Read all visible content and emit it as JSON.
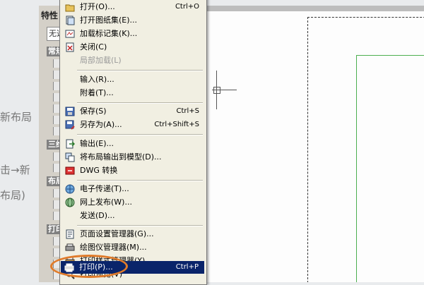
{
  "background": {
    "left_text_1": "新布局",
    "left_text_2": "击→新",
    "left_text_3": "布局)"
  },
  "properties_panel": {
    "title": "特性",
    "selection": "无选",
    "sections": [
      "常规",
      "三维",
      "布局",
      "打印"
    ]
  },
  "file_menu": {
    "items": [
      {
        "label": "打开(O)...",
        "shortcut": "Ctrl+O",
        "icon": "open-folder-icon"
      },
      {
        "label": "打开图纸集(E)...",
        "shortcut": "",
        "icon": "sheet-set-icon"
      },
      {
        "label": "加载标记集(K)...",
        "shortcut": "",
        "icon": "markup-set-icon"
      },
      {
        "label": "关闭(C)",
        "shortcut": "",
        "icon": "close-doc-icon"
      },
      {
        "label": "局部加载(L)",
        "shortcut": "",
        "icon": ""
      },
      {
        "label": "输入(R)...",
        "shortcut": "",
        "icon": ""
      },
      {
        "label": "附着(T)...",
        "shortcut": "",
        "icon": ""
      },
      {
        "label": "保存(S)",
        "shortcut": "Ctrl+S",
        "icon": "save-icon"
      },
      {
        "label": "另存为(A)...",
        "shortcut": "Ctrl+Shift+S",
        "icon": "save-as-icon"
      },
      {
        "label": "输出(E)...",
        "shortcut": "",
        "icon": "export-icon"
      },
      {
        "label": "将布局输出到模型(D)...",
        "shortcut": "",
        "icon": "layout-to-model-icon"
      },
      {
        "label": "DWG 转换",
        "shortcut": "",
        "icon": "dwg-convert-icon"
      },
      {
        "label": "电子传递(T)...",
        "shortcut": "",
        "icon": "etransmit-icon"
      },
      {
        "label": "网上发布(W)...",
        "shortcut": "",
        "icon": "publish-web-icon"
      },
      {
        "label": "发送(D)...",
        "shortcut": "",
        "icon": ""
      },
      {
        "label": "页面设置管理器(G)...",
        "shortcut": "",
        "icon": "page-setup-icon"
      },
      {
        "label": "绘图仪管理器(M)...",
        "shortcut": "",
        "icon": "plotter-icon"
      },
      {
        "label": "打印样式管理器(Y)...",
        "shortcut": "",
        "icon": "plot-style-icon"
      },
      {
        "label": "打印预览(V)",
        "shortcut": "",
        "icon": "preview-icon"
      },
      {
        "label": "打印(P)...",
        "shortcut": "Ctrl+P",
        "icon": "print-icon"
      }
    ],
    "highlighted_item": "打印(P)...",
    "highlight_color": "#0a246a",
    "annotation_ring_color": "#e07b2a"
  }
}
